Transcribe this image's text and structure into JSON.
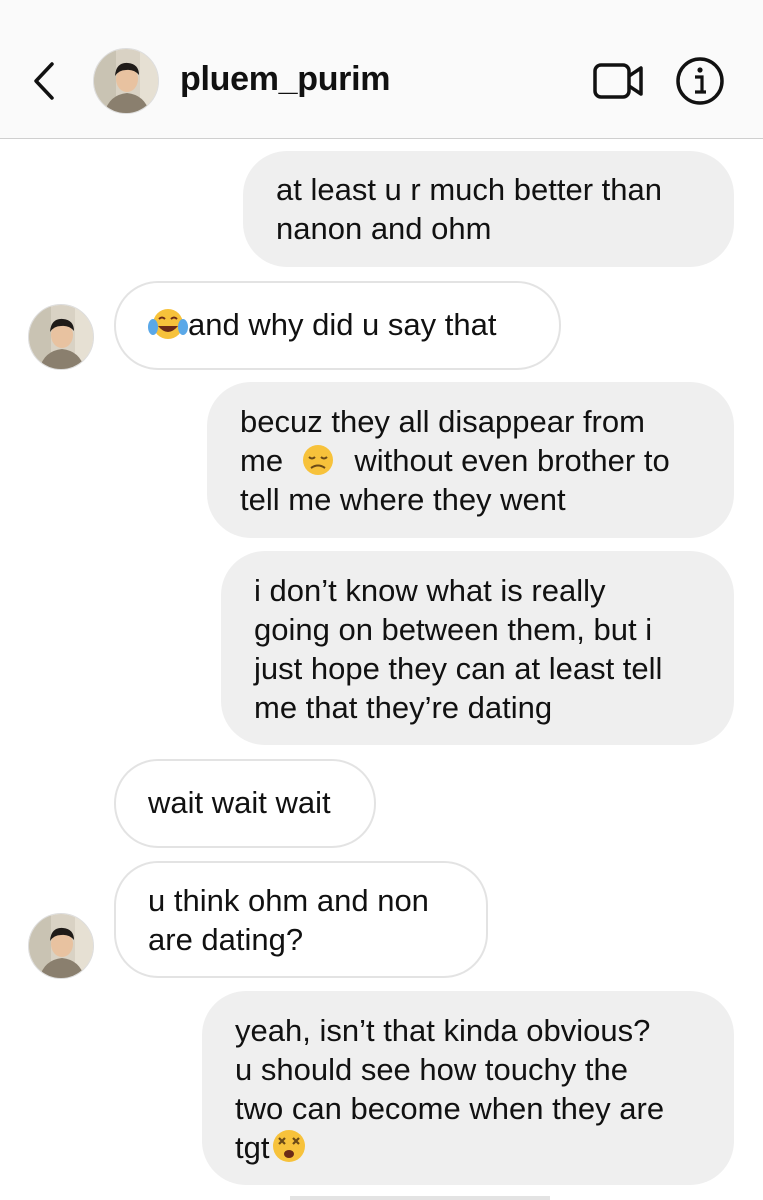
{
  "header": {
    "username": "pluem_purim",
    "back_icon": "chevron-left-icon",
    "video_icon": "video-camera-icon",
    "info_icon": "info-icon"
  },
  "messages": [
    {
      "sender": "me",
      "text": "at least u r much better than nanon and ohm",
      "lines": [
        "at least u r much better than",
        "nanon and ohm"
      ]
    },
    {
      "sender": "pluem_purim",
      "lines": [
        "and why did u say that"
      ],
      "emoji": "face-with-tears-of-joy"
    },
    {
      "sender": "me",
      "lines": [
        "becuz they all disappear from",
        "me",
        "without even brother to",
        "tell me where they went"
      ],
      "emoji": "disappointed-face"
    },
    {
      "sender": "me",
      "lines": [
        "i don’t know what is really",
        "going on between them, but i",
        "just hope they can at least tell",
        "me that they’re dating"
      ]
    },
    {
      "sender": "pluem_purim",
      "lines": [
        "wait wait wait"
      ]
    },
    {
      "sender": "pluem_purim",
      "lines": [
        "u think ohm and non",
        "are dating?"
      ]
    },
    {
      "sender": "me",
      "lines": [
        "yeah, isn’t that kinda obvious?",
        "u should see how touchy the",
        "two can become when they are",
        "tgt"
      ],
      "emoji": "dizzy-face"
    }
  ],
  "colors": {
    "header_bg": "#fafafa",
    "outgoing_bubble": "#efefef",
    "incoming_border": "#e3e3e3",
    "text": "#111111"
  }
}
